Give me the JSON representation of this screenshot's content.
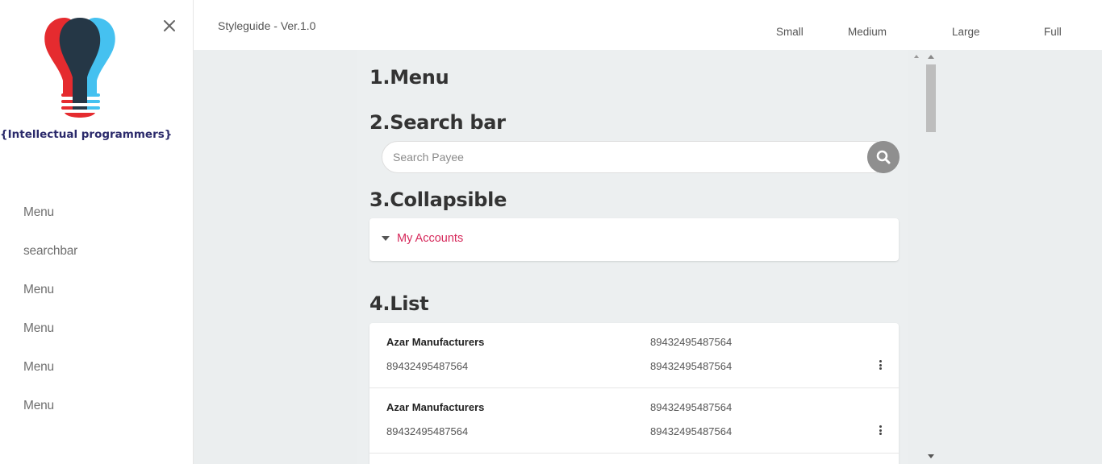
{
  "brand": {
    "name": "{Intellectual programmers}",
    "logo_icon": "lightbulb-logo-icon"
  },
  "sidebar": {
    "close_icon": "close-icon",
    "items": [
      {
        "label": "Menu"
      },
      {
        "label": "searchbar"
      },
      {
        "label": "Menu"
      },
      {
        "label": "Menu"
      },
      {
        "label": "Menu"
      },
      {
        "label": "Menu"
      }
    ]
  },
  "header": {
    "title": "Styleguide - Ver.1.0",
    "sizes": [
      "Small",
      "Medium",
      "Large",
      "Full"
    ]
  },
  "sections": {
    "menu_title": "1.Menu",
    "search_title": "2.Search bar",
    "collapsible_title": "3.Collapsible",
    "list_title": "4.List"
  },
  "search": {
    "placeholder": "Search Payee",
    "value": "",
    "icon": "search-icon"
  },
  "collapsible": {
    "label": "My Accounts",
    "icon": "caret-down-icon"
  },
  "list": {
    "rows": [
      {
        "name": "Azar Manufacturers",
        "sub": "89432495487564",
        "col2_top": "89432495487564",
        "col2_bottom": "89432495487564"
      },
      {
        "name": "Azar Manufacturers",
        "sub": "89432495487564",
        "col2_top": "89432495487564",
        "col2_bottom": "89432495487564"
      }
    ],
    "more_icon": "more-vertical-icon"
  },
  "colors": {
    "accent": "#d6285a",
    "brand_text": "#2b2a6b",
    "logo_red": "#e52b2f",
    "logo_blue": "#45c1f0",
    "logo_dark": "#253746",
    "background": "#eceff0"
  }
}
